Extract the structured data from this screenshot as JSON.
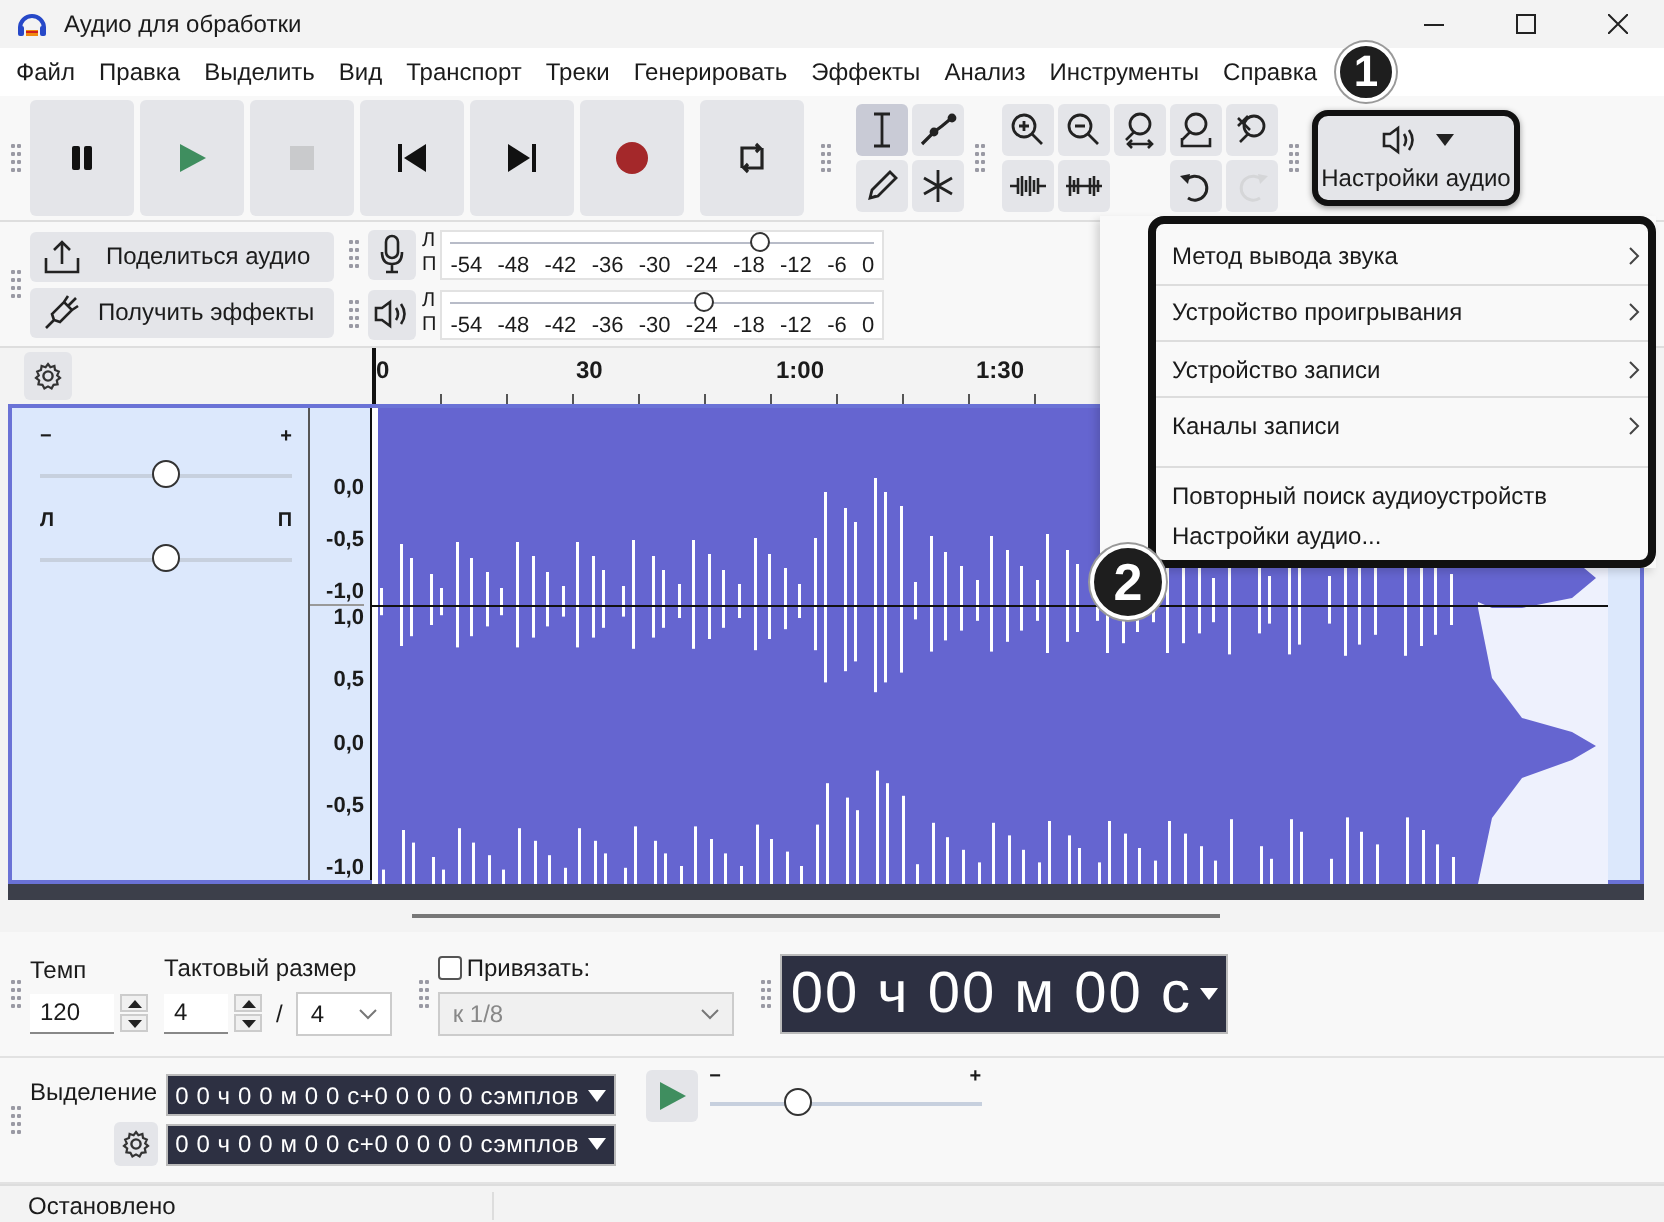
{
  "window": {
    "title": "Аудио для обработки"
  },
  "menu": [
    "Файл",
    "Правка",
    "Выделить",
    "Вид",
    "Транспорт",
    "Треки",
    "Генерировать",
    "Эффекты",
    "Анализ",
    "Инструменты",
    "Справка"
  ],
  "transport": [
    {
      "kind": "pause",
      "disabled": false
    },
    {
      "kind": "play",
      "disabled": false
    },
    {
      "kind": "stop",
      "disabled": true
    },
    {
      "kind": "skip-start",
      "disabled": false
    },
    {
      "kind": "skip-end",
      "disabled": false
    },
    {
      "kind": "record",
      "disabled": false
    },
    {
      "kind": "loop",
      "disabled": false
    }
  ],
  "tools": [
    {
      "kind": "select",
      "selected": true
    },
    {
      "kind": "envelope",
      "selected": false
    },
    {
      "kind": "draw",
      "selected": false
    },
    {
      "kind": "multi",
      "selected": false
    }
  ],
  "zoom": [
    {
      "kind": "zoom-in",
      "disabled": false
    },
    {
      "kind": "zoom-out",
      "disabled": false
    },
    {
      "kind": "zoom-selection",
      "disabled": false
    },
    {
      "kind": "zoom-fit",
      "disabled": false
    },
    {
      "kind": "zoom-toggle",
      "disabled": false
    },
    {
      "kind": "trim",
      "disabled": false
    },
    {
      "kind": "silence",
      "disabled": false
    },
    {
      "kind": "undo",
      "disabled": false
    },
    {
      "kind": "redo",
      "disabled": true
    }
  ],
  "audio_setup": {
    "label": "Настройки аудио"
  },
  "share_button": "Поделиться аудио",
  "effects_button": "Получить эффекты",
  "meters": [
    {
      "kind": "record",
      "channels": [
        "Л",
        "П"
      ],
      "ticks": [
        "-54",
        "-48",
        "-42",
        "-36",
        "-30",
        "-24",
        "-18",
        "-12",
        "-6",
        "0"
      ],
      "level": 0.73
    },
    {
      "kind": "playback",
      "channels": [
        "Л",
        "П"
      ],
      "ticks": [
        "-54",
        "-48",
        "-42",
        "-36",
        "-30",
        "-24",
        "-18",
        "-12",
        "-6",
        "0"
      ],
      "level": 0.6
    }
  ],
  "ruler": [
    "0",
    "30",
    "1:00",
    "1:30"
  ],
  "track": {
    "gain": {
      "minus": "−",
      "plus": "+",
      "level": 0.5
    },
    "pan": {
      "left": "Л",
      "right": "П",
      "level": 0.5
    },
    "scale": [
      [
        "0,0",
        "-0,5",
        "-1,0"
      ],
      [
        "1,0",
        "0,5",
        "0,0",
        "-0,5",
        "-1,0"
      ]
    ]
  },
  "popup_menu": [
    {
      "label": "Метод вывода звука",
      "submenu": true
    },
    {
      "label": "Устройство проигрывания",
      "submenu": true
    },
    {
      "label": "Устройство записи",
      "submenu": true
    },
    {
      "label": "Каналы записи",
      "submenu": true
    },
    {
      "label": "Повторный поиск аудиоустройств",
      "submenu": false
    },
    {
      "label": "Настройки аудио...",
      "submenu": false
    }
  ],
  "badges": [
    "1",
    "2"
  ],
  "tempo": {
    "label": "Темп",
    "value": "120"
  },
  "time_signature": {
    "label": "Тактовый размер",
    "upper": "4",
    "divider": "/",
    "lower": "4"
  },
  "snap": {
    "label": "Привязать:",
    "checked": false,
    "value": "к 1/8"
  },
  "time_display": "00 ч 00 м 00 с",
  "selection": {
    "label": "Выделение",
    "start": "0 0 ч 0 0 м 0 0 с+0 0 0 0 0 сэмплов",
    "end": "0 0 ч 0 0 м 0 0 с+0 0 0 0 0 сэмплов"
  },
  "play_speed": {
    "minus": "−",
    "plus": "+",
    "level": 0.33
  },
  "status": "Остановлено"
}
